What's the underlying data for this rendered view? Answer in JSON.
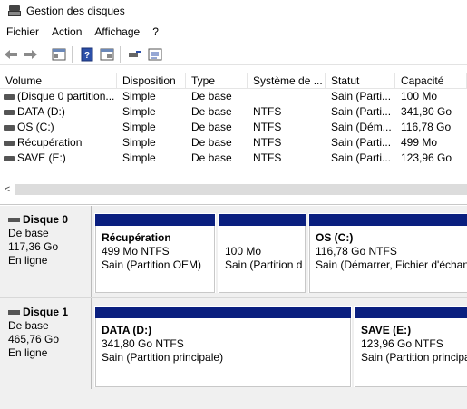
{
  "window": {
    "title": "Gestion des disques"
  },
  "menu": [
    "Fichier",
    "Action",
    "Affichage",
    "?"
  ],
  "toolbar": {
    "icons": [
      "back-arrow-icon",
      "forward-arrow-icon",
      "console-tree-icon",
      "help-icon",
      "properties-icon",
      "details-icon"
    ]
  },
  "volumes": {
    "columns": [
      "Volume",
      "Disposition",
      "Type",
      "Système de ...",
      "Statut",
      "Capacité"
    ],
    "rows": [
      [
        "(Disque 0 partition...",
        "Simple",
        "De base",
        "",
        "Sain (Parti...",
        "100 Mo"
      ],
      [
        "DATA (D:)",
        "Simple",
        "De base",
        "NTFS",
        "Sain (Parti...",
        "341,80 Go"
      ],
      [
        "OS (C:)",
        "Simple",
        "De base",
        "NTFS",
        "Sain (Dém...",
        "116,78 Go"
      ],
      [
        "Récupération",
        "Simple",
        "De base",
        "NTFS",
        "Sain (Parti...",
        "499 Mo"
      ],
      [
        "SAVE (E:)",
        "Simple",
        "De base",
        "NTFS",
        "Sain (Parti...",
        "123,96 Go"
      ]
    ]
  },
  "scroll": {
    "left_arrow": "<"
  },
  "disks": [
    {
      "name": "Disque 0",
      "type": "De base",
      "size": "117,36 Go",
      "state": "En ligne",
      "partitions": [
        {
          "name": "Récupération",
          "line2": "499 Mo NTFS",
          "line3": "Sain (Partition OEM)"
        },
        {
          "name": "",
          "line2": "100 Mo",
          "line3": "Sain (Partition d"
        },
        {
          "name": "OS  (C:)",
          "line2": "116,78 Go NTFS",
          "line3": "Sain (Démarrer, Fichier d'échang"
        }
      ]
    },
    {
      "name": "Disque 1",
      "type": "De base",
      "size": "465,76 Go",
      "state": "En ligne",
      "partitions": [
        {
          "name": "DATA  (D:)",
          "line2": "341,80 Go NTFS",
          "line3": "Sain (Partition principale)"
        },
        {
          "name": "SAVE  (E:)",
          "line2": "123,96 Go NTFS",
          "line3": "Sain (Partition principa"
        }
      ]
    }
  ],
  "colors": {
    "partition_bar": "#0a1f7f"
  }
}
